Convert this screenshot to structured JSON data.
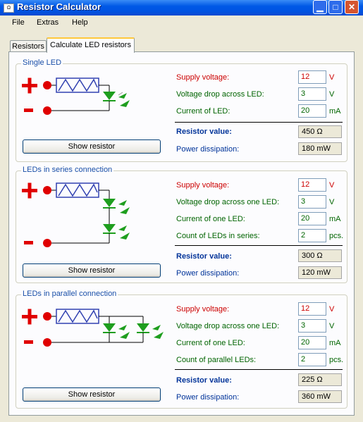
{
  "window": {
    "title": "Resistor Calculator"
  },
  "menu": [
    "File",
    "Extras",
    "Help"
  ],
  "tabs": [
    "Resistors",
    "Calculate LED resistors"
  ],
  "single": {
    "title": "Single LED",
    "supply_label": "Supply voltage:",
    "supply_value": "12",
    "supply_unit": "V",
    "drop_label": "Voltage drop across LED:",
    "drop_value": "3",
    "drop_unit": "V",
    "current_label": "Current of LED:",
    "current_value": "20",
    "current_unit": "mA",
    "resistor_label": "Resistor value:",
    "resistor_value": "450 Ω",
    "power_label": "Power dissipation:",
    "power_value": "180 mW",
    "button": "Show resistor"
  },
  "series": {
    "title": "LEDs in series connection",
    "supply_label": "Supply voltage:",
    "supply_value": "12",
    "supply_unit": "V",
    "drop_label": "Voltage drop across one LED:",
    "drop_value": "3",
    "drop_unit": "V",
    "current_label": "Current of one LED:",
    "current_value": "20",
    "current_unit": "mA",
    "count_label": "Count of LEDs in series:",
    "count_value": "2",
    "count_unit": "pcs.",
    "resistor_label": "Resistor value:",
    "resistor_value": "300 Ω",
    "power_label": "Power dissipation:",
    "power_value": "120 mW",
    "button": "Show resistor"
  },
  "parallel": {
    "title": "LEDs in parallel connection",
    "supply_label": "Supply voltage:",
    "supply_value": "12",
    "supply_unit": "V",
    "drop_label": "Voltage drop across one LED:",
    "drop_value": "3",
    "drop_unit": "V",
    "current_label": "Current of one LED:",
    "current_value": "20",
    "current_unit": "mA",
    "count_label": "Count of parallel LEDs:",
    "count_value": "2",
    "count_unit": "pcs.",
    "resistor_label": "Resistor value:",
    "resistor_value": "225 Ω",
    "power_label": "Power dissipation:",
    "power_value": "360 mW",
    "button": "Show resistor"
  },
  "colors": {
    "red": "#CC0000",
    "green": "#006400",
    "blue": "#003399",
    "led": "#1E9E1E"
  }
}
